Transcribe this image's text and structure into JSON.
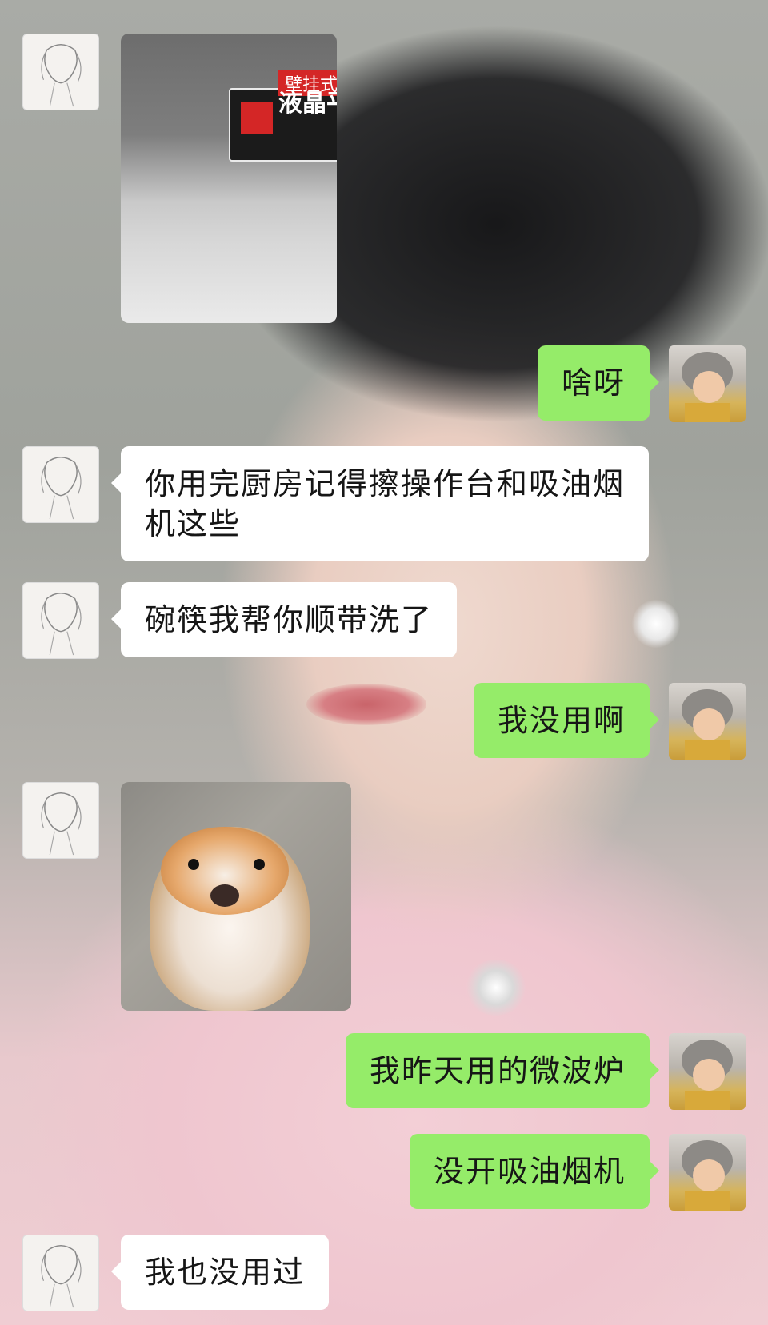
{
  "colors": {
    "self_bubble": "#95ec69",
    "other_bubble": "#ffffff",
    "text": "#161616"
  },
  "messages": [
    {
      "from": "other",
      "type": "image",
      "image": "range-hood-photo",
      "image_text": {
        "top": "壁挂式",
        "title": "液晶平"
      }
    },
    {
      "from": "self",
      "type": "text",
      "text": "啥呀"
    },
    {
      "from": "other",
      "type": "text",
      "text": "你用完厨房记得擦操作台和吸油烟机这些"
    },
    {
      "from": "other",
      "type": "text",
      "text": "碗筷我帮你顺带洗了"
    },
    {
      "from": "self",
      "type": "text",
      "text": "我没用啊"
    },
    {
      "from": "other",
      "type": "image",
      "image": "scared-hamster-sticker"
    },
    {
      "from": "self",
      "type": "text",
      "text": "我昨天用的微波炉"
    },
    {
      "from": "self",
      "type": "text",
      "text": "没开吸油烟机"
    },
    {
      "from": "other",
      "type": "text",
      "text": "我也没用过"
    }
  ]
}
